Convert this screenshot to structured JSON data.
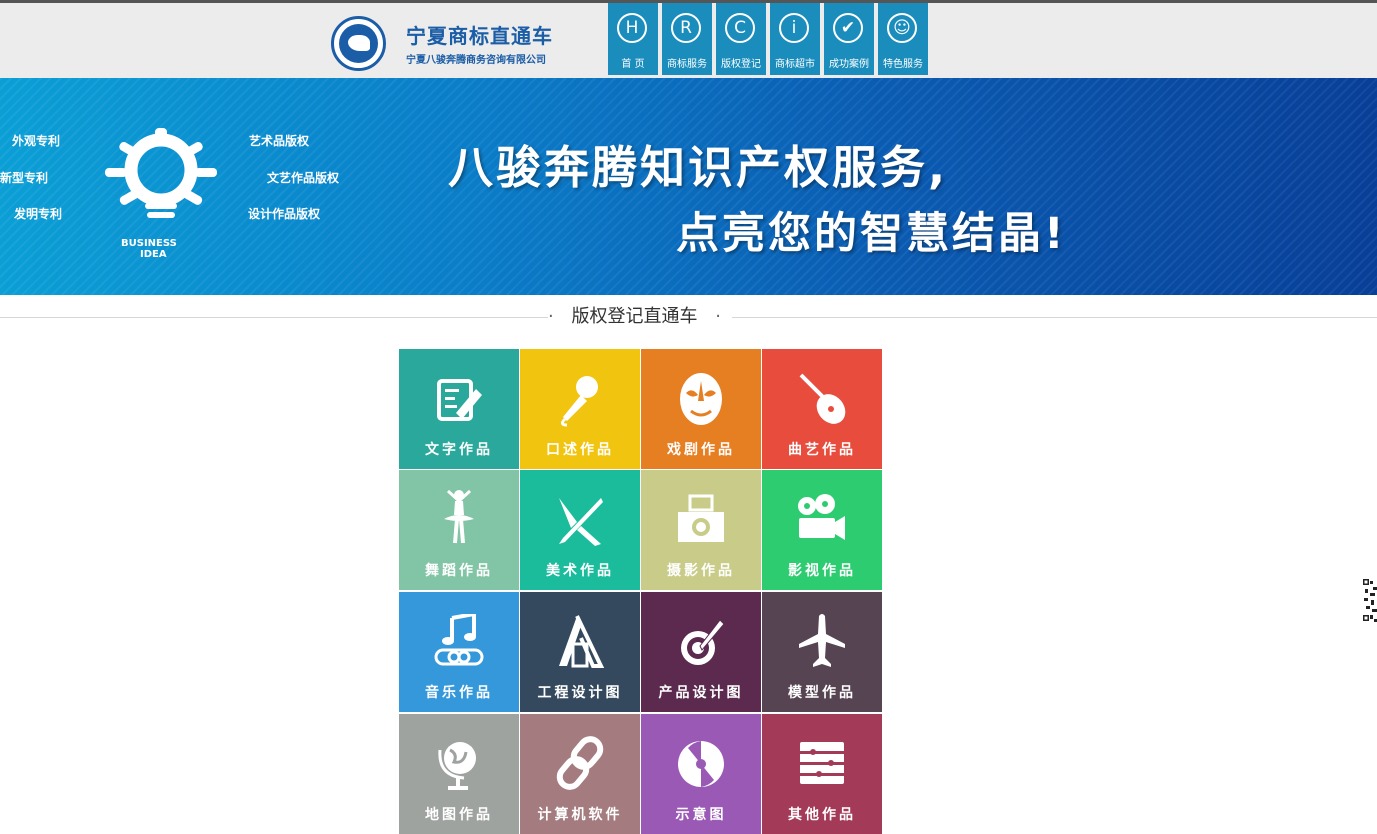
{
  "header": {
    "brand_title": "宁夏商标直通车",
    "brand_subtitle": "宁夏八骏奔腾商务咨询有限公司"
  },
  "nav": [
    {
      "icon": "H",
      "label": "首 页"
    },
    {
      "icon": "R",
      "label": "商标服务"
    },
    {
      "icon": "C",
      "label": "版权登记"
    },
    {
      "icon": "i",
      "label": "商标超市"
    },
    {
      "icon": "✔",
      "label": "成功案例"
    },
    {
      "icon": "☺",
      "label": "特色服务"
    }
  ],
  "banner": {
    "labels_left": [
      "外观专利",
      "新型专利",
      "发明专利"
    ],
    "labels_right": [
      "艺术品版权",
      "文艺作品版权",
      "设计作品版权"
    ],
    "business_text": "BUSINESS",
    "idea_text": "IDEA",
    "slogan_line1": "八骏奔腾知识产权服务,",
    "slogan_line2": "点亮您的智慧结晶!"
  },
  "section": {
    "title": "版权登记直通车",
    "dot": "·"
  },
  "tiles": [
    {
      "label": "文字作品",
      "color": "#2aa89b",
      "icon": "pencil-paper-icon"
    },
    {
      "label": "口述作品",
      "color": "#f1c40f",
      "icon": "microphone-icon"
    },
    {
      "label": "戏剧作品",
      "color": "#e67e22",
      "icon": "opera-mask-icon"
    },
    {
      "label": "曲艺作品",
      "color": "#e74c3c",
      "icon": "pipa-icon"
    },
    {
      "label": "舞蹈作品",
      "color": "#82c4a6",
      "icon": "ballet-dancer-icon"
    },
    {
      "label": "美术作品",
      "color": "#1abc9c",
      "icon": "brush-pencil-icon"
    },
    {
      "label": "摄影作品",
      "color": "#c8cc88",
      "icon": "camera-icon"
    },
    {
      "label": "影视作品",
      "color": "#2ecc71",
      "icon": "film-projector-icon"
    },
    {
      "label": "音乐作品",
      "color": "#3498db",
      "icon": "music-note-icon"
    },
    {
      "label": "工程设计图",
      "color": "#34495e",
      "icon": "architecture-icon"
    },
    {
      "label": "产品设计图",
      "color": "#5b2a4e",
      "icon": "target-pen-icon"
    },
    {
      "label": "模型作品",
      "color": "#574453",
      "icon": "airplane-icon"
    },
    {
      "label": "地图作品",
      "color": "#9fa3a0",
      "icon": "globe-icon"
    },
    {
      "label": "计算机软件",
      "color": "#a47b7f",
      "icon": "link-icon"
    },
    {
      "label": "示意图",
      "color": "#9b59b6",
      "icon": "disc-icon"
    },
    {
      "label": "其他作品",
      "color": "#a33a58",
      "icon": "sliders-icon"
    }
  ]
}
